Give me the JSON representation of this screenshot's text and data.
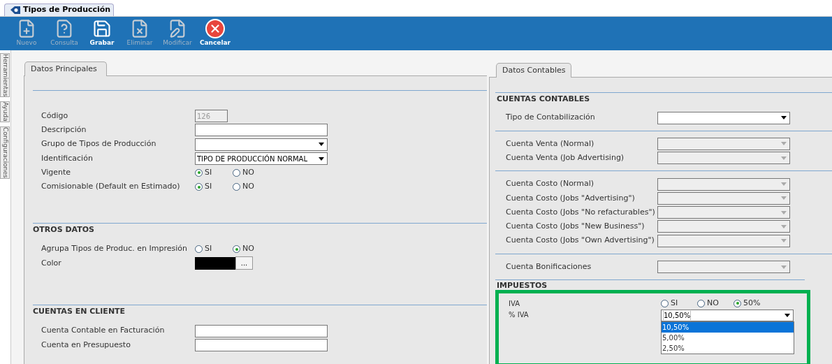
{
  "window_tab": {
    "title": "Tipos de Producción",
    "selected": true
  },
  "toolbar": [
    {
      "label": "Nuevo",
      "disabled": true
    },
    {
      "label": "Consulta",
      "disabled": true
    },
    {
      "label": "Grabar",
      "disabled": false
    },
    {
      "label": "Eliminar",
      "disabled": true
    },
    {
      "label": "Modificar",
      "disabled": true
    },
    {
      "label": "Cancelar",
      "disabled": false
    }
  ],
  "side_tabs": [
    "Herramientas",
    "Ayuda",
    "Configuraciones"
  ],
  "left_panel": {
    "tab": "Datos Principales",
    "sections": [
      {
        "fields": [
          {
            "kind": "text",
            "label": "Código",
            "value": "126",
            "disabled": true,
            "short": true
          },
          {
            "kind": "text",
            "label": "Descripción",
            "disabled": false
          },
          {
            "kind": "select",
            "label": "Grupo de Tipos de Producción",
            "disabled": false
          },
          {
            "kind": "select",
            "label": "Identificación",
            "value": "TIPO DE PRODUCCIÓN NORMAL",
            "disabled": false
          },
          {
            "kind": "radio",
            "label": "Vigente",
            "options": [
              {
                "label": "SI",
                "selected": true
              },
              {
                "label": "NO",
                "selected": false
              }
            ]
          },
          {
            "kind": "radio",
            "label": "Comisionable (Default en Estimado)",
            "options": [
              {
                "label": "SI",
                "selected": true
              },
              {
                "label": "NO",
                "selected": false
              }
            ]
          }
        ]
      },
      {
        "title": "OTROS DATOS",
        "fields": [
          {
            "kind": "radio",
            "label": "Agrupa Tipos de Produc. en Impresión",
            "options": [
              {
                "label": "SI",
                "selected": false
              },
              {
                "label": "NO",
                "selected": true
              }
            ]
          },
          {
            "kind": "color",
            "label": "Color",
            "color": "#000000",
            "button": "..."
          }
        ]
      },
      {
        "title": "CUENTAS EN CLIENTE",
        "fields": [
          {
            "kind": "text",
            "label": "Cuenta Contable en Facturación",
            "disabled": false
          },
          {
            "kind": "text",
            "label": "Cuenta en Presupuesto",
            "disabled": false
          }
        ]
      }
    ]
  },
  "right_panel": {
    "tab": "Datos Contables",
    "accounts_title": "CUENTAS CONTABLES",
    "groups": [
      [
        {
          "kind": "select",
          "label": "Tipo de Contabilización",
          "disabled": false
        }
      ],
      [
        {
          "kind": "select",
          "label": "Cuenta Venta (Normal)",
          "disabled": true
        },
        {
          "kind": "select",
          "label": "Cuenta Venta (Job Advertising)",
          "disabled": true
        }
      ],
      [
        {
          "kind": "select",
          "label": "Cuenta Costo (Normal)",
          "disabled": true
        },
        {
          "kind": "select",
          "label": "Cuenta Costo (Jobs \"Advertising\")",
          "disabled": true
        },
        {
          "kind": "select",
          "label": "Cuenta Costo (Jobs \"No refacturables\")",
          "disabled": true
        },
        {
          "kind": "select",
          "label": "Cuenta Costo (Jobs \"New Business\")",
          "disabled": true
        },
        {
          "kind": "select",
          "label": "Cuenta Costo (Jobs \"Own Advertising\")",
          "disabled": true
        }
      ],
      [
        {
          "kind": "select",
          "label": "Cuenta Bonificaciones",
          "disabled": true
        }
      ]
    ],
    "taxes": {
      "title": "IMPUESTOS",
      "highlighted": true,
      "iva": {
        "label": "IVA",
        "options": [
          {
            "label": "SI",
            "selected": false
          },
          {
            "label": "NO",
            "selected": false
          },
          {
            "label": "50%",
            "selected": true
          }
        ]
      },
      "iva_percent": {
        "label": "% IVA",
        "value": "10,50%",
        "expanded": true,
        "options": [
          {
            "label": "10,50%",
            "selected": true
          },
          {
            "label": "5,00%",
            "selected": false
          },
          {
            "label": "2,50%",
            "selected": false
          }
        ]
      }
    }
  }
}
